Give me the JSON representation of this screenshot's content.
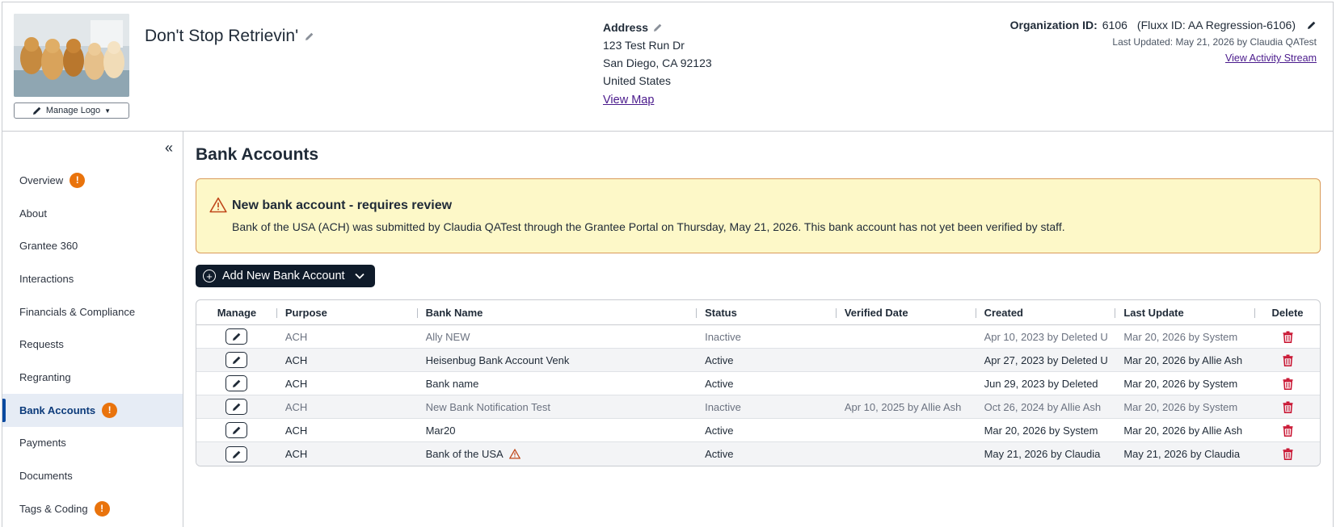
{
  "header": {
    "org_name": "Don't Stop Retrievin'",
    "manage_logo_label": "Manage Logo",
    "address": {
      "title": "Address",
      "line1": "123 Test Run Dr",
      "line2": "San Diego, CA 92123",
      "line3": "United States",
      "map_link": "View Map"
    },
    "org_id": {
      "label": "Organization ID:",
      "value": "6106",
      "fluxx": "(Fluxx ID: AA Regression-6106)",
      "last_updated": "Last Updated: May 21, 2026 by Claudia QATest",
      "activity_link": "View Activity Stream"
    }
  },
  "sidebar": {
    "items": [
      {
        "label": "Overview",
        "badge": "!"
      },
      {
        "label": "About",
        "badge": ""
      },
      {
        "label": "Grantee 360",
        "badge": ""
      },
      {
        "label": "Interactions",
        "badge": ""
      },
      {
        "label": "Financials & Compliance",
        "badge": ""
      },
      {
        "label": "Requests",
        "badge": ""
      },
      {
        "label": "Regranting",
        "badge": ""
      },
      {
        "label": "Bank Accounts",
        "badge": "!"
      },
      {
        "label": "Payments",
        "badge": ""
      },
      {
        "label": "Documents",
        "badge": ""
      },
      {
        "label": "Tags & Coding",
        "badge": "!"
      }
    ]
  },
  "main": {
    "title": "Bank Accounts",
    "alert": {
      "title": "New bank account - requires review",
      "text": "Bank of the USA (ACH) was submitted by Claudia QATest through the Grantee Portal on Thursday, May 21, 2026. This bank account has not yet been verified by staff."
    },
    "add_button_label": "Add New Bank Account",
    "table": {
      "headers": [
        "Manage",
        "Purpose",
        "Bank Name",
        "Status",
        "Verified Date",
        "Created",
        "Last Update",
        "Delete"
      ],
      "rows": [
        {
          "purpose": "ACH",
          "bank": "Ally NEW",
          "status": "Inactive",
          "verified": "",
          "created": "Apr 10, 2023 by Deleted U",
          "updated": "Mar 20, 2026 by System",
          "warn": false
        },
        {
          "purpose": "ACH",
          "bank": "Heisenbug Bank Account Venk",
          "status": "Active",
          "verified": "",
          "created": "Apr 27, 2023 by Deleted U",
          "updated": "Mar 20, 2026 by Allie Ash",
          "warn": false
        },
        {
          "purpose": "ACH",
          "bank": "Bank name",
          "status": "Active",
          "verified": "",
          "created": "Jun 29, 2023 by Deleted",
          "updated": "Mar 20, 2026 by System",
          "warn": false
        },
        {
          "purpose": "ACH",
          "bank": "New Bank Notification Test",
          "status": "Inactive",
          "verified": "Apr 10, 2025 by Allie Ash",
          "created": "Oct 26, 2024 by Allie Ash",
          "updated": "Mar 20, 2026 by System",
          "warn": false
        },
        {
          "purpose": "ACH",
          "bank": "Mar20",
          "status": "Active",
          "verified": "",
          "created": "Mar 20, 2026 by System",
          "updated": "Mar 20, 2026 by Allie Ash",
          "warn": false
        },
        {
          "purpose": "ACH",
          "bank": "Bank of the USA",
          "status": "Active",
          "verified": "",
          "created": "May 21, 2026 by Claudia",
          "updated": "May 21, 2026 by Claudia",
          "warn": true
        }
      ]
    }
  },
  "colors": {
    "accent_dark": "#0f1b2a",
    "badge_orange": "#e9730c",
    "alert_bg": "#fdf8c8",
    "delete_red": "#c8102e",
    "link_purple": "#4a1a8c"
  }
}
